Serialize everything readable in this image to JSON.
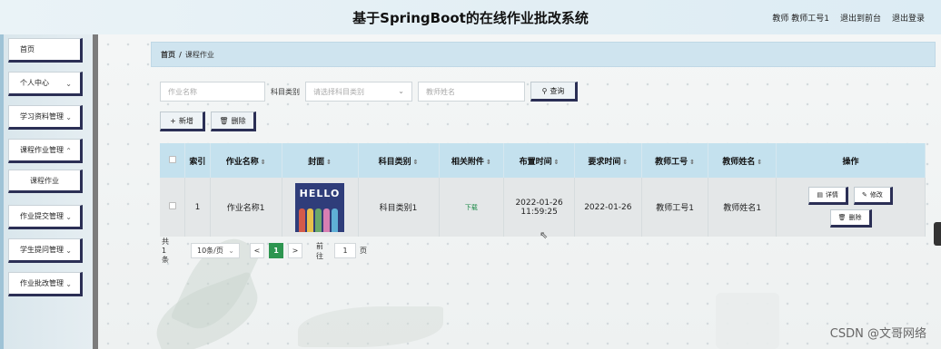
{
  "header": {
    "title": "基于SpringBoot的在线作业批改系统",
    "user": "教师 教师工号1",
    "to_front": "退出到前台",
    "logout": "退出登录"
  },
  "sidebar": {
    "items": [
      {
        "label": "首页",
        "has_chevron": false
      },
      {
        "label": "个人中心",
        "has_chevron": true
      },
      {
        "label": "学习资料管理",
        "has_chevron": true
      },
      {
        "label": "课程作业管理",
        "has_chevron": true
      },
      {
        "label": "课程作业",
        "submenu": true
      },
      {
        "label": "作业提交管理",
        "has_chevron": true
      },
      {
        "label": "学生提问管理",
        "has_chevron": true
      },
      {
        "label": "作业批改管理",
        "has_chevron": true
      }
    ]
  },
  "breadcrumb": {
    "home": "首页",
    "sep": "/",
    "current": "课程作业"
  },
  "search": {
    "name_placeholder": "作业名称",
    "category_label": "科目类别",
    "category_placeholder": "请选择科目类别",
    "teacher_placeholder": "教师姓名",
    "query_label": "查询"
  },
  "actions": {
    "add_label": "新增",
    "delete_label": "删除"
  },
  "table": {
    "headers": [
      "索引",
      "作业名称",
      "封面",
      "科目类别",
      "相关附件",
      "布置时间",
      "要求时间",
      "教师工号",
      "教师姓名",
      "操作"
    ],
    "rows": [
      {
        "index": "1",
        "name": "作业名称1",
        "cover_text": "HELLO",
        "category": "科目类别1",
        "attachment": "下载",
        "assign_time": "2022-01-26 11:59:25",
        "due_time": "2022-01-26",
        "teacher_id": "教师工号1",
        "teacher_name": "教师姓名1",
        "ops": {
          "detail": "详情",
          "edit": "修改",
          "delete": "删除"
        }
      }
    ]
  },
  "pagination": {
    "total": "共 1 条",
    "page_size": "10条/页",
    "prev": "<",
    "current": "1",
    "next": ">",
    "goto_label": "前往",
    "goto_value": "1",
    "page_suffix": "页"
  },
  "watermark": "CSDN @文哥网络",
  "colors": {
    "accent": "#2b2f55",
    "header_row": "#c4e1ee",
    "active_page": "#2d9550",
    "download": "#1c8a48"
  }
}
